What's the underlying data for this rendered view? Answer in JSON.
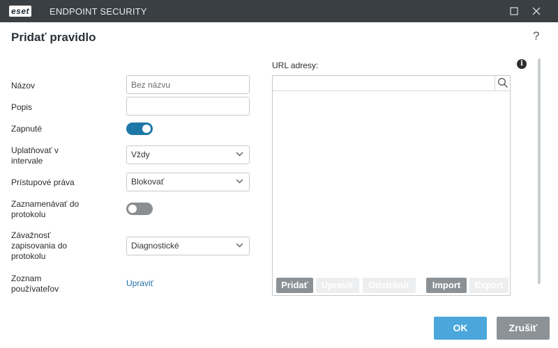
{
  "window": {
    "brand": "eset",
    "app_title": "ENDPOINT SECURITY",
    "icons": {
      "maximize": "maximize-icon",
      "close": "close-icon"
    }
  },
  "dialog": {
    "title": "Pridať pravidlo",
    "help": "?"
  },
  "form": {
    "name_label": "Názov",
    "name_placeholder": "Bez názvu",
    "name_value": "",
    "description_label": "Popis",
    "description_value": "",
    "enabled_label": "Zapnuté",
    "enabled_on": true,
    "apply_interval_label": "Uplatňovať v intervale",
    "apply_interval_value": "Vždy",
    "access_rights_label": "Prístupové práva",
    "access_rights_value": "Blokovať",
    "log_label": "Zaznamenávať do protokolu",
    "log_on": false,
    "severity_label": "Závažnosť zapisovania do protokolu",
    "severity_value": "Diagnostické",
    "user_list_label": "Zoznam používateľov",
    "user_list_link": "Upraviť"
  },
  "urls": {
    "label": "URL adresy:",
    "search_value": "",
    "items": [],
    "buttons": {
      "add": "Pridať",
      "edit": "Upraviť",
      "remove": "Odstrániť",
      "import": "Import",
      "export": "Export"
    }
  },
  "footer": {
    "ok": "OK",
    "cancel": "Zrušiť"
  },
  "colors": {
    "titlebar": "#3a3f44",
    "accent": "#1f77a8",
    "ok_button": "#4aa6db",
    "cancel_button": "#8d9296"
  }
}
